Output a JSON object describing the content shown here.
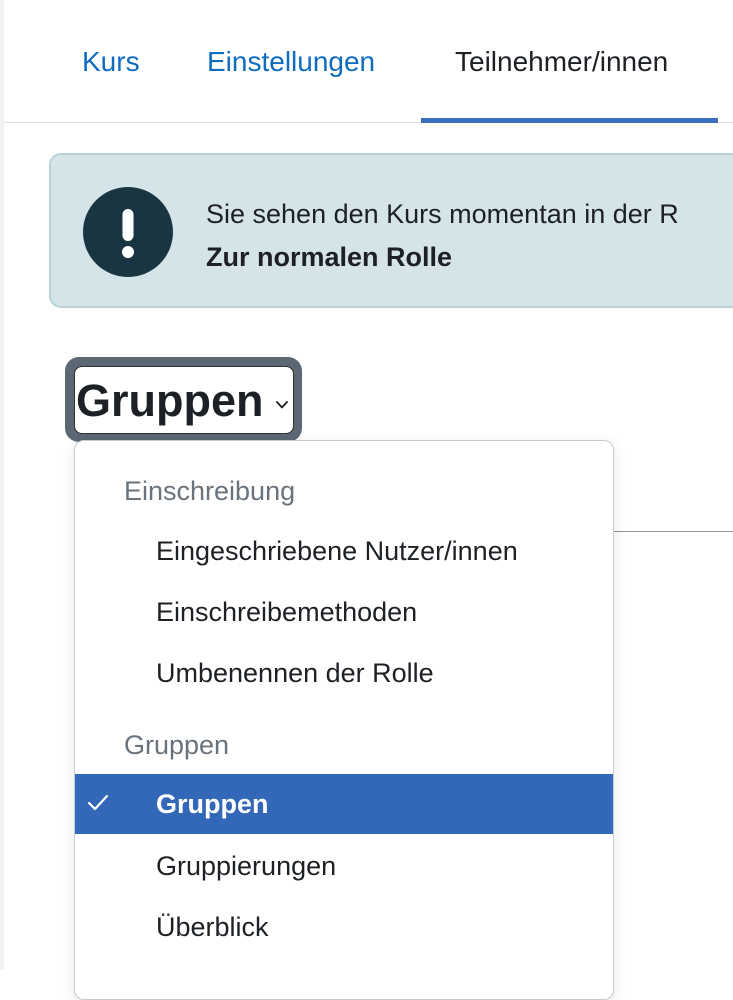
{
  "tabs": [
    {
      "label": "Kurs"
    },
    {
      "label": "Einstellungen"
    },
    {
      "label": "Teilnehmer/innen",
      "active": true
    }
  ],
  "alert": {
    "icon": "exclamation-icon",
    "message": "Sie sehen den Kurs momentan in der R",
    "link": "Zur normalen Rolle"
  },
  "select": {
    "selected": "Gruppen",
    "icon": "chevron-down-icon"
  },
  "menu": {
    "groups": [
      {
        "header": "Einschreibung",
        "items": [
          {
            "label": "Eingeschriebene Nutzer/innen"
          },
          {
            "label": "Einschreibemethoden"
          },
          {
            "label": "Umbenennen der Rolle"
          }
        ]
      },
      {
        "header": "Gruppen",
        "items": [
          {
            "label": "Gruppen",
            "selected": true
          },
          {
            "label": "Gruppierungen"
          },
          {
            "label": "Überblick"
          }
        ]
      }
    ]
  },
  "colors": {
    "link": "#0f6cbf",
    "active_tab_underline": "#3a6ebd",
    "alert_bg": "#d5e4e8",
    "alert_icon_bg": "#193541",
    "selected_item_bg": "#3368b9"
  }
}
